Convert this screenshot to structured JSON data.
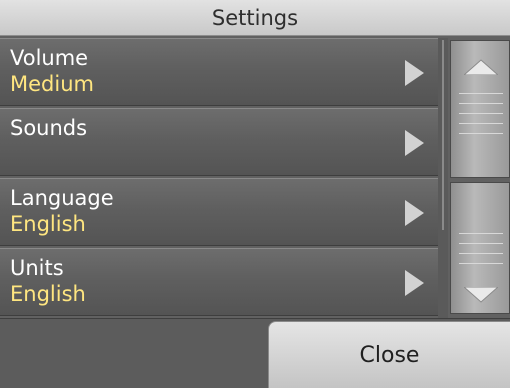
{
  "window": {
    "title": "Settings"
  },
  "settings": [
    {
      "label": "Volume",
      "value": "Medium"
    },
    {
      "label": "Sounds",
      "value": ""
    },
    {
      "label": "Language",
      "value": "English"
    },
    {
      "label": "Units",
      "value": "English"
    }
  ],
  "footer": {
    "close_label": "Close"
  },
  "colors": {
    "row_label": "#ffffff",
    "row_value": "#ffe680",
    "titlebar": "#d4d4d4",
    "background": "#616161"
  },
  "icons": {
    "row_chevron": "chevron-right-icon",
    "scroll_up": "arrow-up-icon",
    "scroll_down": "arrow-down-icon"
  }
}
